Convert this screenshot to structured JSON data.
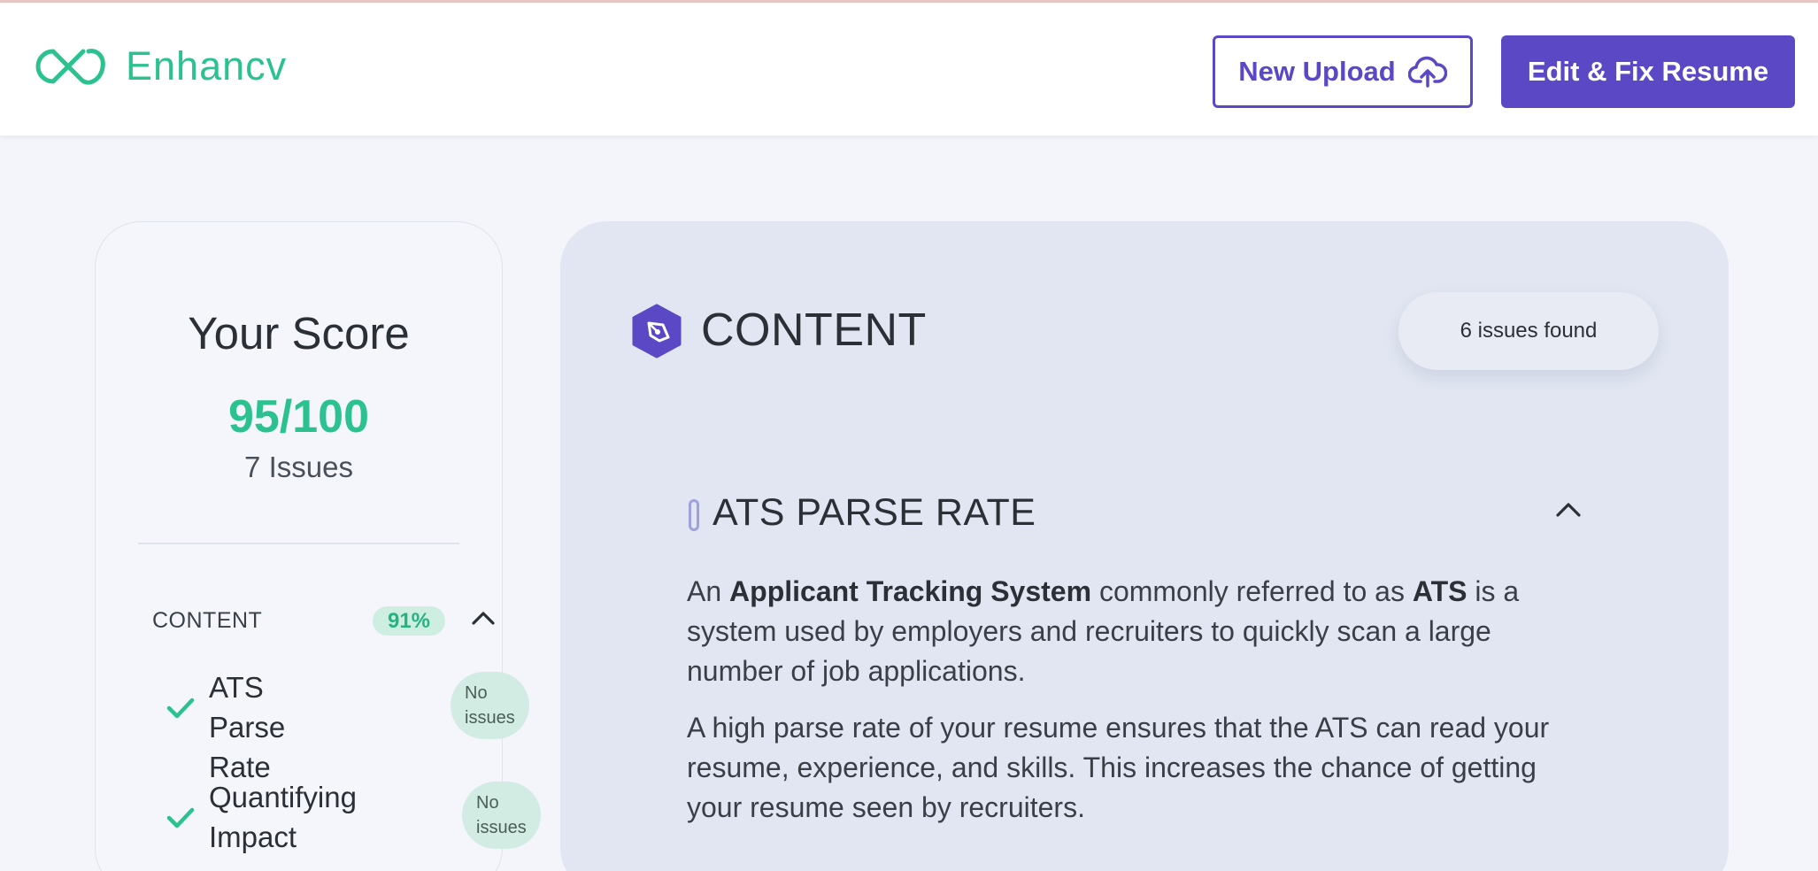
{
  "header": {
    "logo_text": "Enhancv",
    "upload_label": "New Upload",
    "fix_label": "Edit & Fix Resume"
  },
  "score": {
    "title": "Your Score",
    "value": "95/100",
    "issues": "7 Issues"
  },
  "sidebar": {
    "category": {
      "label": "CONTENT",
      "percent": "91%"
    },
    "items": [
      {
        "label_line1": "ATS Parse",
        "label_line2": "Rate",
        "badge_line1": "No",
        "badge_line2": "issues"
      },
      {
        "label_line1": "Quantifying",
        "label_line2": "Impact",
        "badge_line1": "No",
        "badge_line2": "issues"
      }
    ]
  },
  "content": {
    "title": "CONTENT",
    "issues_found": "6 issues found",
    "section_title": "ATS PARSE RATE",
    "para1": {
      "t1": "An ",
      "b1": "Applicant Tracking System",
      "t2": " commonly referred to as ",
      "b2": "ATS",
      "t3": " is a system used by employers and recruiters to quickly scan a large number of job applications."
    },
    "para2": "A high parse rate of your resume ensures that the ATS can read your resume, experience, and skills. This increases the chance of getting your resume seen by recruiters."
  },
  "colors": {
    "brand_green": "#2cc28f",
    "brand_purple": "#5a48c4",
    "card_blue": "#e1e6f2"
  },
  "icons": [
    "enhancv-logo-icon",
    "cloud-upload-icon",
    "chevron-up-icon",
    "check-icon",
    "pen-tool-icon"
  ]
}
